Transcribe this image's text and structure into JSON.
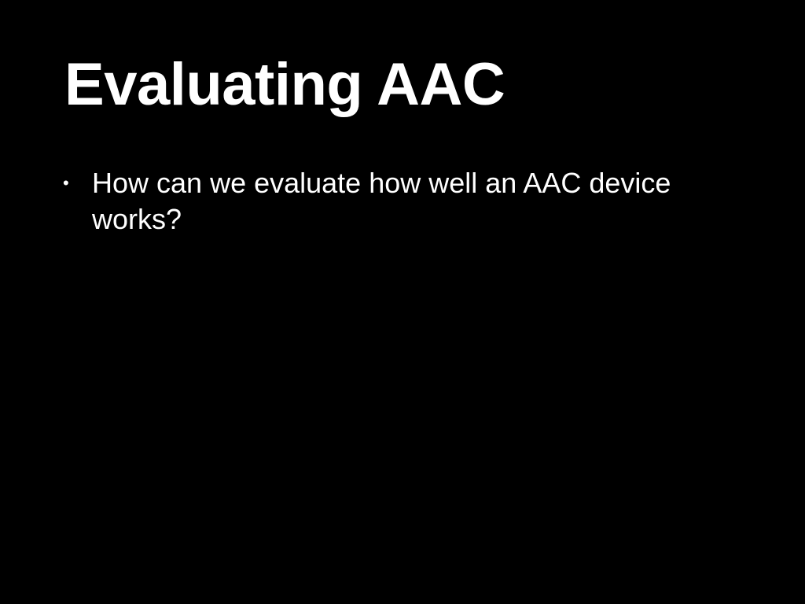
{
  "slide": {
    "title": "Evaluating AAC",
    "bullets": [
      {
        "marker": "•",
        "text": "How can we evaluate how well an AAC device works?"
      }
    ]
  },
  "colors": {
    "background": "#000000",
    "text": "#ffffff"
  }
}
